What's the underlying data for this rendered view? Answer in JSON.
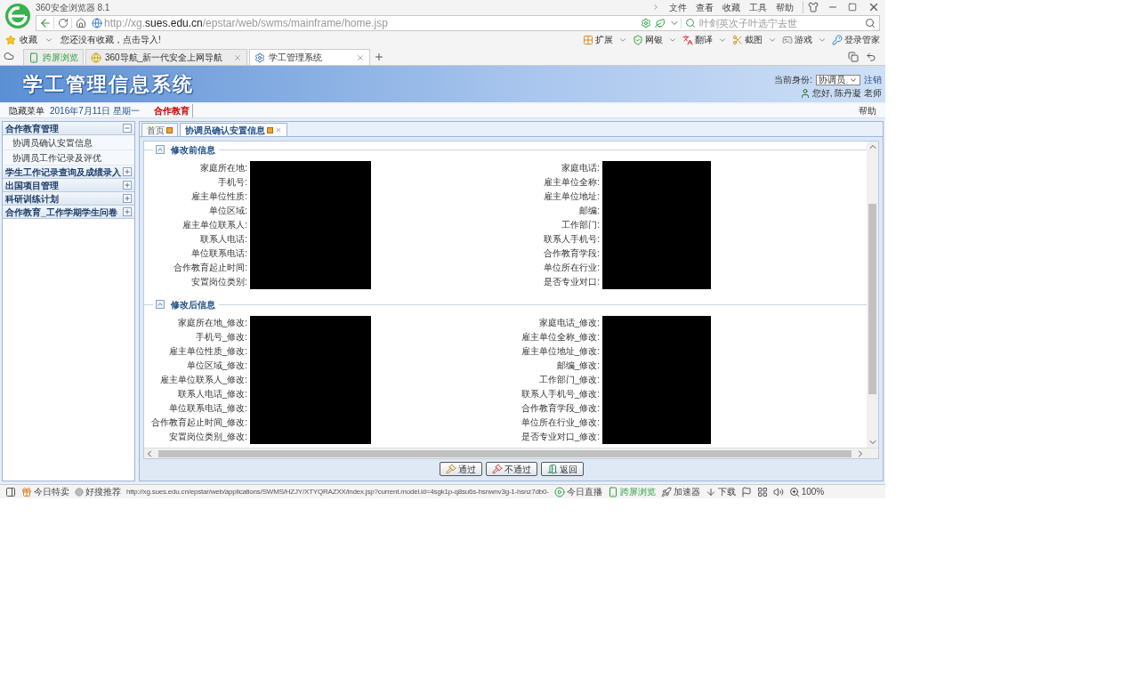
{
  "browser": {
    "title": "360安全浏览器 8.1",
    "menu": [
      "文件",
      "查看",
      "收藏",
      "工具",
      "帮助"
    ],
    "address": {
      "url": "http://xg.**sues.edu.cn**/epstar/web/swms/mainframe/home.jsp"
    },
    "search": {
      "placeholder": "叶剑英次子叶选宁去世"
    },
    "favorites": {
      "label": "收藏",
      "hint": "您还没有收藏，点击导入!"
    },
    "tools": [
      {
        "label": "扩展",
        "kind": "grid",
        "dropdown": true
      },
      {
        "label": "网银",
        "kind": "shield",
        "dropdown": true
      },
      {
        "label": "翻译",
        "kind": "translate",
        "dropdown": true
      },
      {
        "label": "截图",
        "kind": "scissors",
        "dropdown": true
      },
      {
        "label": "游戏",
        "kind": "game",
        "dropdown": true
      },
      {
        "label": "登录管家",
        "kind": "key",
        "dropdown": false
      }
    ],
    "tabs": [
      {
        "label": "跨屏浏览",
        "kind": "phone",
        "selected": false,
        "closable": false
      },
      {
        "label": "360导航_新一代安全上网导航",
        "kind": "globe",
        "selected": false,
        "closable": true
      },
      {
        "label": "学工管理系统",
        "kind": "app",
        "selected": true,
        "closable": true
      }
    ]
  },
  "app": {
    "title": "学工管理信息系统",
    "identity_label": "当前身份:",
    "role": "协调员",
    "logout": "注销",
    "greeting": "您好, 陈丹凝 老师",
    "hide_menu": "隐藏菜单",
    "date": "2016年7月11日 星期一",
    "module": "合作教育",
    "help": "帮助"
  },
  "sidebar": [
    {
      "label": "合作教育管理",
      "expanded": true,
      "children": [
        {
          "label": "协调员确认安置信息"
        },
        {
          "label": "协调员工作记录及评优"
        }
      ]
    },
    {
      "label": "学生工作记录查询及成绩录入",
      "expanded": false
    },
    {
      "label": "出国项目管理",
      "expanded": false
    },
    {
      "label": "科研训练计划",
      "expanded": false
    },
    {
      "label": "合作教育_工作学期学生问卷",
      "expanded": false
    }
  ],
  "content_tabs": [
    {
      "label": "首页",
      "selected": false,
      "closable": false
    },
    {
      "label": "协调员确认安置信息",
      "selected": true,
      "closable": true
    }
  ],
  "sections": [
    {
      "title": "修改前信息",
      "expanded": true,
      "left": [
        "家庭所在地:",
        "手机号:",
        "雇主单位性质:",
        "单位区域:",
        "雇主单位联系人:",
        "联系人电话:",
        "单位联系电话:",
        "合作教育起止时间:",
        "安置岗位类别:"
      ],
      "right": [
        "家庭电话:",
        "雇主单位全称:",
        "雇主单位地址:",
        "邮编:",
        "工作部门:",
        "联系人手机号:",
        "合作教育学段:",
        "单位所在行业:",
        "是否专业对口:"
      ]
    },
    {
      "title": "修改后信息",
      "expanded": true,
      "left": [
        "家庭所在地_修改:",
        "手机号_修改:",
        "雇主单位性质_修改:",
        "单位区域_修改:",
        "雇主单位联系人_修改:",
        "联系人电话_修改:",
        "单位联系电话_修改:",
        "合作教育起止时间_修改:",
        "安置岗位类别_修改:"
      ],
      "right": [
        "家庭电话_修改:",
        "雇主单位全称_修改:",
        "雇主单位地址_修改:",
        "邮编_修改:",
        "工作部门_修改:",
        "联系人手机号_修改:",
        "合作教育学段_修改:",
        "单位所在行业_修改:",
        "是否专业对口_修改:"
      ]
    }
  ],
  "buttons": [
    {
      "label": "通过",
      "kind": "approve"
    },
    {
      "label": "不通过",
      "kind": "reject"
    },
    {
      "label": "返回",
      "kind": "back"
    }
  ],
  "status_bar": {
    "left": [
      {
        "label": "今日特卖",
        "kind": "gift"
      },
      {
        "label": "好搜推荐",
        "kind": "dot"
      }
    ],
    "url": "http://xg.sues.edu.cn/epstar/web/applications/SWMS/HZJY/XTYQRAZXX/index.jsp?current.model.id=4sgk1p-q8su6s-hsnwnv3g-1-hsnz7db0-",
    "right": [
      {
        "label": "今日直播",
        "kind": "play"
      },
      {
        "label": "跨屏浏览",
        "kind": "phone"
      },
      {
        "label": "加速器",
        "kind": "rocket"
      },
      {
        "label": "下载",
        "kind": "download"
      }
    ],
    "zoom": "100%"
  }
}
